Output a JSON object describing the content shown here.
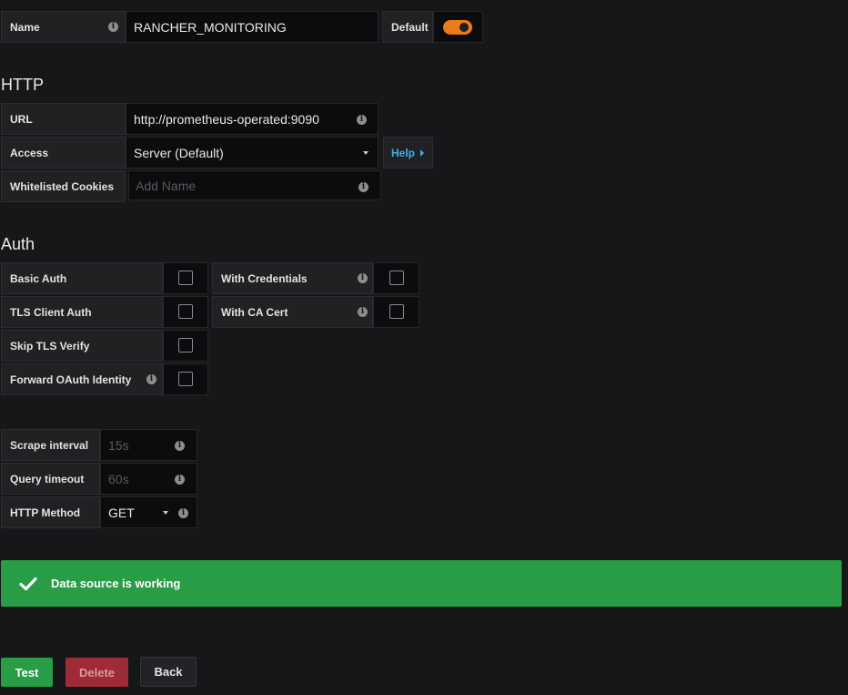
{
  "general": {
    "name_label": "Name",
    "name_value": "RANCHER_MONITORING",
    "default_label": "Default",
    "default_enabled": true
  },
  "http": {
    "section_title": "HTTP",
    "url_label": "URL",
    "url_value": "http://prometheus-operated:9090",
    "access_label": "Access",
    "access_value": "Server (Default)",
    "help_label": "Help",
    "cookies_label": "Whitelisted Cookies",
    "cookies_placeholder": "Add Name"
  },
  "auth": {
    "section_title": "Auth",
    "basic_auth_label": "Basic Auth",
    "with_credentials_label": "With Credentials",
    "tls_client_auth_label": "TLS Client Auth",
    "with_ca_cert_label": "With CA Cert",
    "skip_tls_verify_label": "Skip TLS Verify",
    "forward_oauth_label": "Forward OAuth Identity"
  },
  "prometheus": {
    "scrape_interval_label": "Scrape interval",
    "scrape_interval_placeholder": "15s",
    "query_timeout_label": "Query timeout",
    "query_timeout_placeholder": "60s",
    "http_method_label": "HTTP Method",
    "http_method_value": "GET"
  },
  "status": {
    "message": "Data source is working",
    "color": "#299c46"
  },
  "actions": {
    "test_label": "Test",
    "delete_label": "Delete",
    "back_label": "Back"
  },
  "colors": {
    "background": "#161719",
    "accent_orange": "#eb7b18",
    "success_green": "#299c46",
    "danger_red": "#9e2b37",
    "link_blue": "#33b5e5"
  }
}
